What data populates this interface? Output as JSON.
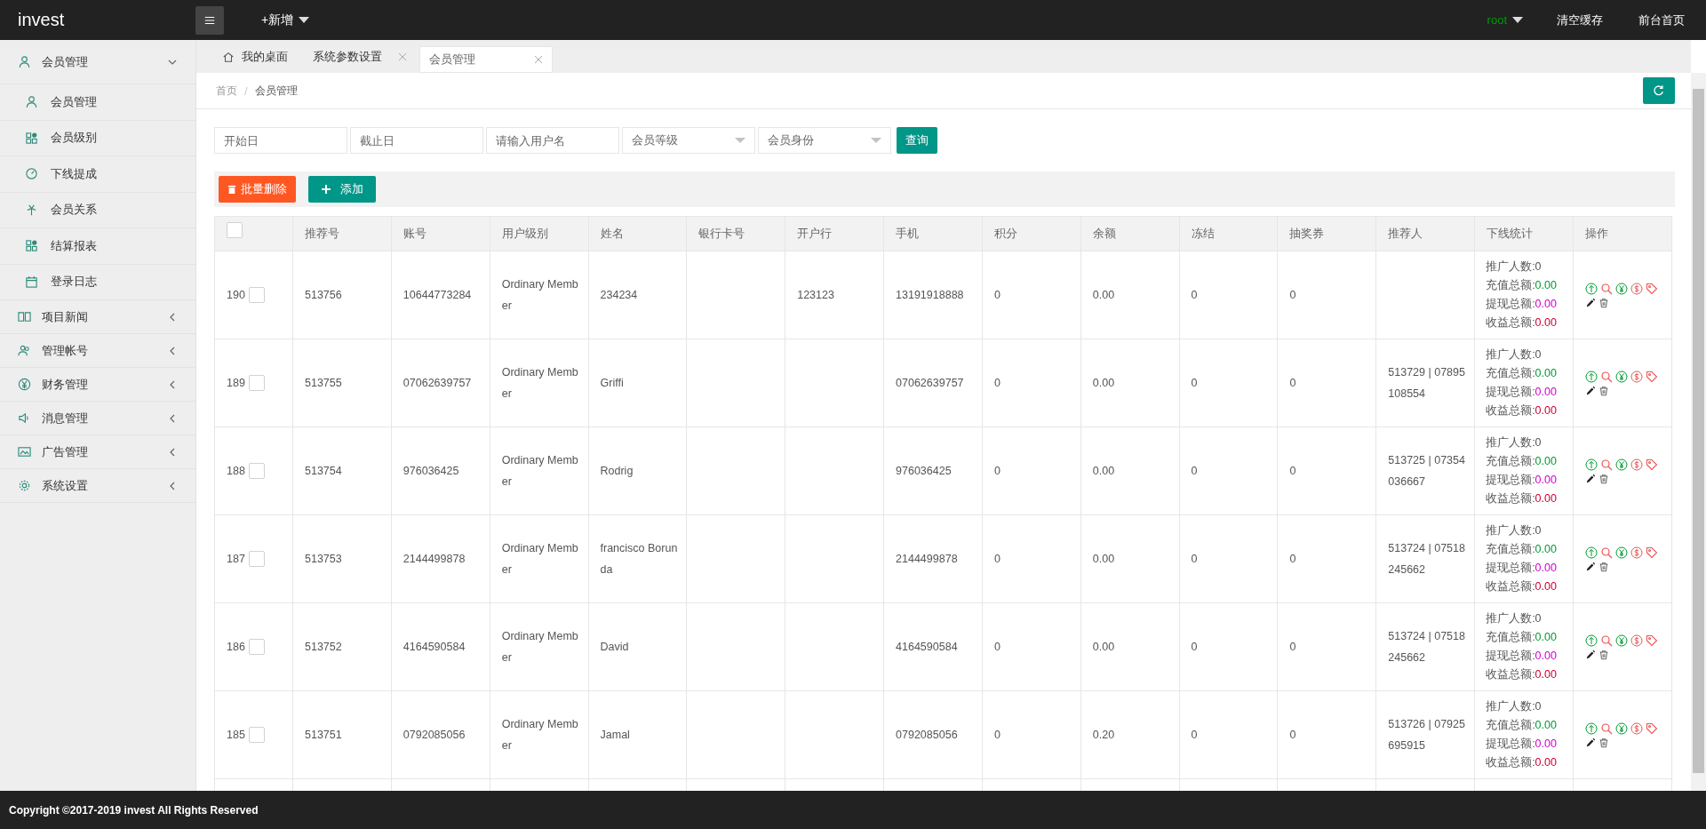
{
  "header": {
    "logo": "invest",
    "add_menu": "+新增",
    "user": "root",
    "links": [
      "清空缓存",
      "前台首页"
    ]
  },
  "sidebar": {
    "groups": [
      {
        "label": "会员管理",
        "expanded": true,
        "children": [
          {
            "label": "会员管理"
          },
          {
            "label": "会员级别"
          },
          {
            "label": "下线提成"
          },
          {
            "label": "会员关系"
          },
          {
            "label": "结算报表"
          },
          {
            "label": "登录日志"
          }
        ]
      },
      {
        "label": "项目新闻",
        "expanded": false
      },
      {
        "label": "管理帐号",
        "expanded": false
      },
      {
        "label": "财务管理",
        "expanded": false
      },
      {
        "label": "消息管理",
        "expanded": false
      },
      {
        "label": "广告管理",
        "expanded": false
      },
      {
        "label": "系统设置",
        "expanded": false
      }
    ]
  },
  "tabs": [
    {
      "label": "我的桌面",
      "closable": false,
      "selected": false
    },
    {
      "label": "系统参数设置",
      "closable": true,
      "selected": false
    },
    {
      "label": "会员管理",
      "closable": true,
      "selected": true
    }
  ],
  "breadcrumb": {
    "separator": "/",
    "items": [
      "首页",
      "会员管理"
    ]
  },
  "filters": {
    "start": {
      "placeholder": "开始日"
    },
    "end": {
      "placeholder": "截止日"
    },
    "username": {
      "placeholder": "请输入用户名"
    },
    "selects": [
      "会员等级",
      "会员身份"
    ],
    "search_button": "查询"
  },
  "toolbar": {
    "delete_button": "批量删除",
    "add_button": "添加"
  },
  "table": {
    "columns": [
      "推荐号",
      "账号",
      "用户级别",
      "姓名",
      "银行卡号",
      "开户行",
      "手机",
      "积分",
      "余额",
      "冻结",
      "抽奖券",
      "推荐人",
      "下线统计",
      "操作"
    ],
    "header_checked": false,
    "rows": [
      {
        "id": "190",
        "checked": false,
        "cells": [
          "513756",
          "10644773284",
          "Ordinary Member",
          "234234",
          "",
          "123123",
          "13191918888",
          "0",
          "0.00",
          "0",
          "0",
          ""
        ],
        "stats": [
          {
            "kind": "count",
            "label": "推广人数:",
            "value": "0"
          },
          {
            "kind": "recharge",
            "label": "充值总额:",
            "value": "0.00"
          },
          {
            "kind": "withdraw",
            "label": "提现总额:",
            "value": "0.00"
          },
          {
            "kind": "income",
            "label": "收益总额:",
            "value": "0.00"
          }
        ]
      },
      {
        "id": "189",
        "checked": false,
        "cells": [
          "513755",
          "07062639757",
          "Ordinary Member",
          "Griffi",
          "",
          "",
          "07062639757",
          "0",
          "0.00",
          "0",
          "0",
          "513729 | 07895108554"
        ],
        "stats": [
          {
            "kind": "count",
            "label": "推广人数:",
            "value": "0"
          },
          {
            "kind": "recharge",
            "label": "充值总额:",
            "value": "0.00"
          },
          {
            "kind": "withdraw",
            "label": "提现总额:",
            "value": "0.00"
          },
          {
            "kind": "income",
            "label": "收益总额:",
            "value": "0.00"
          }
        ]
      },
      {
        "id": "188",
        "checked": false,
        "cells": [
          "513754",
          "976036425",
          "Ordinary Member",
          "Rodrig",
          "",
          "",
          "976036425",
          "0",
          "0.00",
          "0",
          "0",
          "513725 | 07354036667"
        ],
        "stats": [
          {
            "kind": "count",
            "label": "推广人数:",
            "value": "0"
          },
          {
            "kind": "recharge",
            "label": "充值总额:",
            "value": "0.00"
          },
          {
            "kind": "withdraw",
            "label": "提现总额:",
            "value": "0.00"
          },
          {
            "kind": "income",
            "label": "收益总额:",
            "value": "0.00"
          }
        ]
      },
      {
        "id": "187",
        "checked": false,
        "cells": [
          "513753",
          "2144499878",
          "Ordinary Member",
          "francisco Borunda",
          "",
          "",
          "2144499878",
          "0",
          "0.00",
          "0",
          "0",
          "513724 | 07518245662"
        ],
        "stats": [
          {
            "kind": "count",
            "label": "推广人数:",
            "value": "0"
          },
          {
            "kind": "recharge",
            "label": "充值总额:",
            "value": "0.00"
          },
          {
            "kind": "withdraw",
            "label": "提现总额:",
            "value": "0.00"
          },
          {
            "kind": "income",
            "label": "收益总额:",
            "value": "0.00"
          }
        ]
      },
      {
        "id": "186",
        "checked": false,
        "cells": [
          "513752",
          "4164590584",
          "Ordinary Member",
          "David",
          "",
          "",
          "4164590584",
          "0",
          "0.00",
          "0",
          "0",
          "513724 | 07518245662"
        ],
        "stats": [
          {
            "kind": "count",
            "label": "推广人数:",
            "value": "0"
          },
          {
            "kind": "recharge",
            "label": "充值总额:",
            "value": "0.00"
          },
          {
            "kind": "withdraw",
            "label": "提现总额:",
            "value": "0.00"
          },
          {
            "kind": "income",
            "label": "收益总额:",
            "value": "0.00"
          }
        ]
      },
      {
        "id": "185",
        "checked": false,
        "cells": [
          "513751",
          "0792085056",
          "Ordinary Member",
          "Jamal",
          "",
          "",
          "0792085056",
          "0",
          "0.20",
          "0",
          "0",
          "513726 | 07925695915"
        ],
        "stats": [
          {
            "kind": "count",
            "label": "推广人数:",
            "value": "0"
          },
          {
            "kind": "recharge",
            "label": "充值总额:",
            "value": "0.00"
          },
          {
            "kind": "withdraw",
            "label": "提现总额:",
            "value": "0.00"
          },
          {
            "kind": "income",
            "label": "收益总额:",
            "value": "0.00"
          }
        ]
      }
    ]
  },
  "footer": "Copyright ©2017-2019 invest All Rights Reserved"
}
